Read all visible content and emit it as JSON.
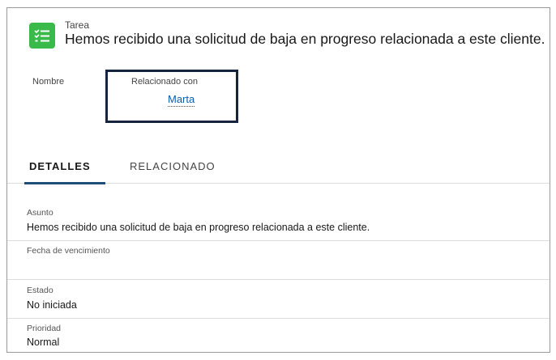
{
  "header": {
    "record_type": "Tarea",
    "title": "Hemos recibido una solicitud de baja en progreso relacionada a este cliente."
  },
  "highlights": {
    "name_label": "Nombre",
    "related_label": "Relacionado con",
    "related_value": "Marta"
  },
  "tabs": [
    {
      "label": "DETALLES",
      "active": true
    },
    {
      "label": "RELACIONADO",
      "active": false
    }
  ],
  "fields": [
    {
      "label": "Asunto",
      "value": "Hemos recibido una solicitud de baja en progreso relacionada a este cliente."
    },
    {
      "label": "Fecha de vencimiento",
      "value": ""
    },
    {
      "label": "Estado",
      "value": "No iniciada"
    },
    {
      "label": "Prioridad",
      "value": "Normal"
    }
  ],
  "colors": {
    "task_icon": "#3bba4c",
    "link": "#0b5cab",
    "highlight_border": "#16253d",
    "active_tab_underline": "#1f4e79"
  },
  "icons": {
    "task": "task-checklist-icon"
  }
}
